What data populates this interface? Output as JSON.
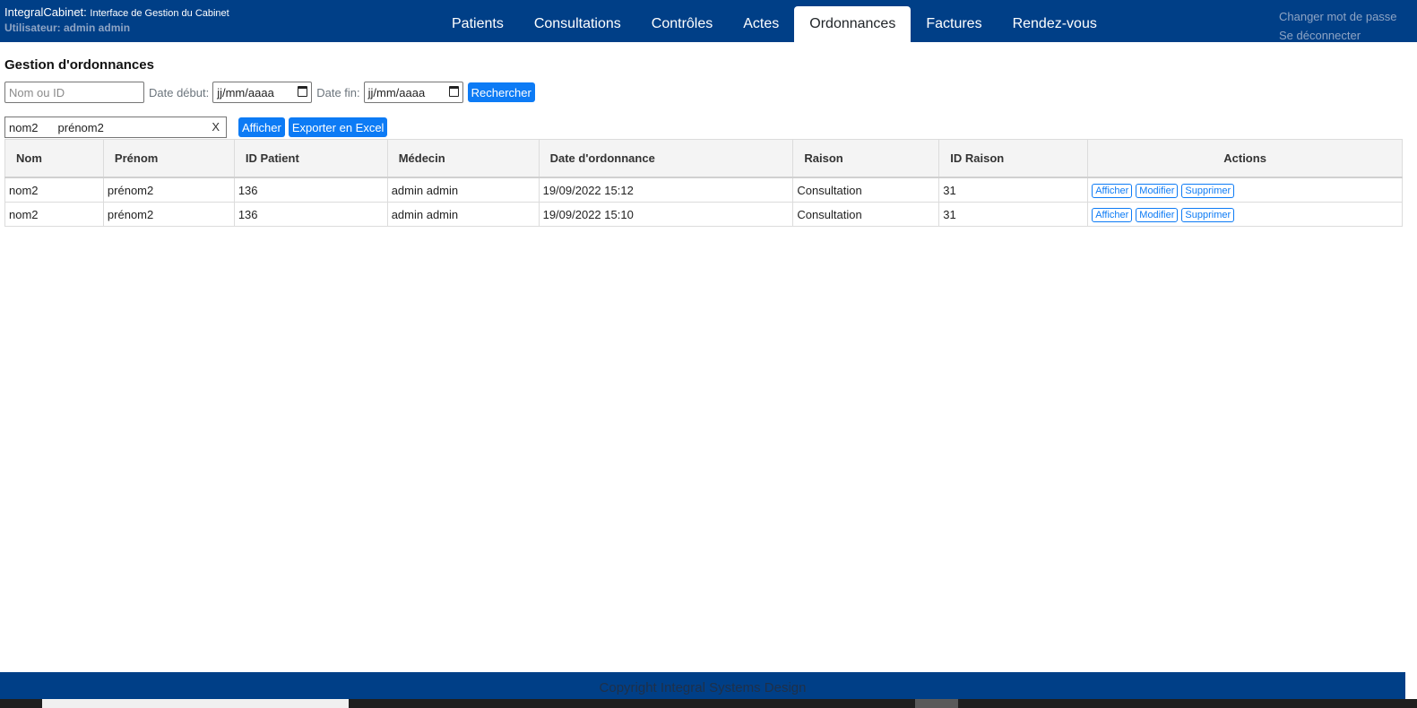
{
  "header": {
    "app_name": "IntegralCabinet:",
    "app_subtitle": "Interface de Gestion du Cabinet",
    "user_line": "Utilisateur: admin admin",
    "change_password": "Changer mot de passe",
    "logout": "Se déconnecter"
  },
  "nav": {
    "tabs": [
      {
        "label": "Patients"
      },
      {
        "label": "Consultations"
      },
      {
        "label": "Contrôles"
      },
      {
        "label": "Actes"
      },
      {
        "label": "Ordonnances",
        "active": true
      },
      {
        "label": "Factures"
      },
      {
        "label": "Rendez-vous"
      }
    ]
  },
  "main": {
    "title": "Gestion d'ordonnances",
    "search": {
      "placeholder": "Nom ou ID",
      "date_start_label": "Date début:",
      "date_start_value": "jj/mm/aaaa",
      "date_end_label": "Date fin:",
      "date_end_value": "jj/mm/aaaa",
      "button": "Rechercher"
    },
    "selected_patient": {
      "nom": "nom2",
      "prenom": "prénom2",
      "clear": "X"
    },
    "afficher_button": "Afficher",
    "export_button": "Exporter en Excel"
  },
  "table": {
    "headers": [
      "Nom",
      "Prénom",
      "ID Patient",
      "Médecin",
      "Date d'ordonnance",
      "Raison",
      "ID Raison",
      "Actions"
    ],
    "rows": [
      {
        "nom": "nom2",
        "prenom": "prénom2",
        "id_patient": "136",
        "medecin": "admin admin",
        "date": "19/09/2022 15:12",
        "raison": "Consultation",
        "id_raison": "31"
      },
      {
        "nom": "nom2",
        "prenom": "prénom2",
        "id_patient": "136",
        "medecin": "admin admin",
        "date": "19/09/2022 15:10",
        "raison": "Consultation",
        "id_raison": "31"
      }
    ],
    "actions": {
      "view": "Afficher",
      "edit": "Modifier",
      "delete": "Supprimer"
    }
  },
  "footer": {
    "copyright": "Copyright Integral Systems Design"
  },
  "colors": {
    "header_bg": "#003f87",
    "button_blue": "#0d7bf5"
  }
}
